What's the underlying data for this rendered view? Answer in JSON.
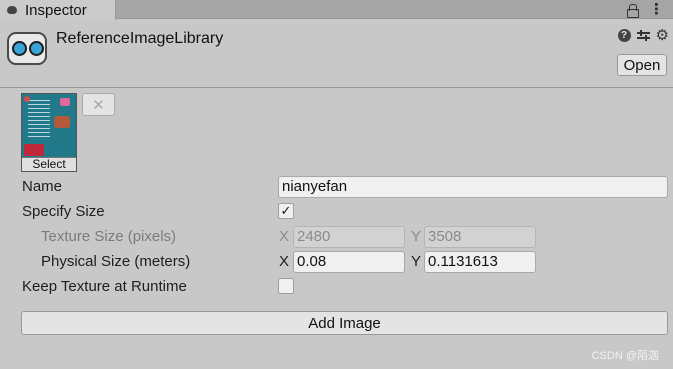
{
  "tab": {
    "label": "Inspector",
    "icon": "info-icon"
  },
  "header": {
    "title": "ReferenceImageLibrary",
    "open_label": "Open",
    "help_glyph": "?",
    "gear_glyph": "⚙",
    "kebab_glyph": "⋮"
  },
  "texture": {
    "select_label": "Select",
    "clear_glyph": "✕"
  },
  "fields": {
    "name_label": "Name",
    "name_value": "nianyefan",
    "specify_size_label": "Specify Size",
    "specify_size_checked": "✓",
    "texture_size_label": "Texture Size (pixels)",
    "texture_size_x_axis": "X",
    "texture_size_x": "2480",
    "texture_size_y_axis": "Y",
    "texture_size_y": "3508",
    "physical_size_label": "Physical Size (meters)",
    "physical_size_x_axis": "X",
    "physical_size_x": "0.08",
    "physical_size_y_axis": "Y",
    "physical_size_y": "0.1131613",
    "keep_texture_label": "Keep Texture at Runtime",
    "keep_texture_checked": ""
  },
  "add_image_label": "Add Image",
  "watermark": "CSDN @陌迦"
}
